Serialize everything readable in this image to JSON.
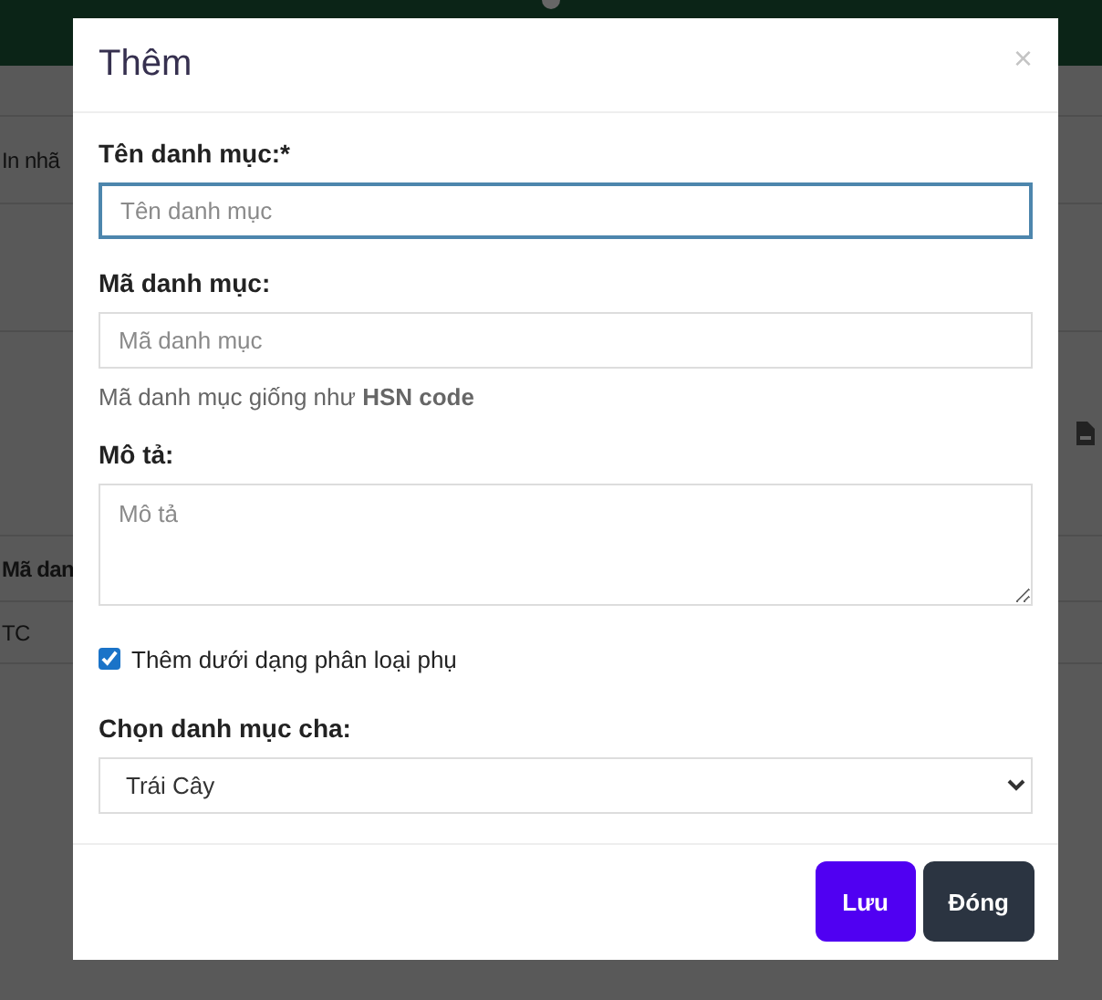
{
  "background": {
    "toolbar_text": "In nhã",
    "column_header": "Mã dan",
    "cell": "TC"
  },
  "modal": {
    "title": "Thêm",
    "close": "×",
    "fields": [
      {
        "kind": "input",
        "label": "Tên danh mục:*",
        "placeholder": "Tên danh mục",
        "focused": true
      },
      {
        "kind": "input",
        "label": "Mã danh mục:",
        "placeholder": "Mã danh mục",
        "focused": false,
        "help": "Mã danh mục giống như **HSN code**"
      },
      {
        "kind": "textarea",
        "label": "Mô tả:",
        "placeholder": "Mô tả",
        "focused": false
      },
      {
        "kind": "checkbox",
        "label": "Thêm dưới dạng phân loại phụ",
        "checked": true
      },
      {
        "kind": "select",
        "label": "Chọn danh mục cha:",
        "value": "Trái Cây"
      }
    ],
    "buttons": [
      {
        "label": "Lưu",
        "kind": "primary"
      },
      {
        "label": "Đóng",
        "kind": "secondary"
      }
    ]
  }
}
